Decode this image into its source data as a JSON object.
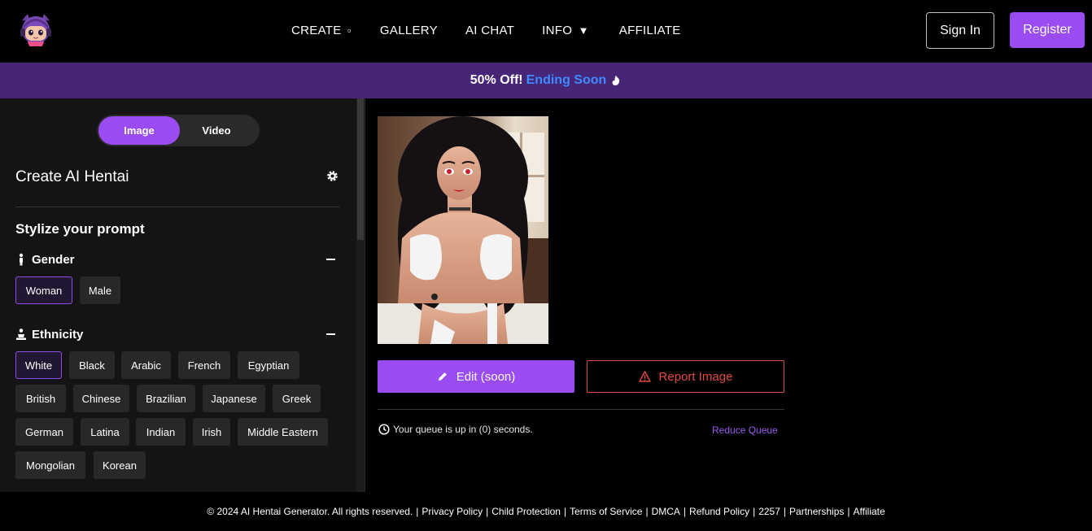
{
  "nav": {
    "links": [
      {
        "label": "CREATE",
        "caret": "▫"
      },
      {
        "label": "GALLERY"
      },
      {
        "label": "AI CHAT"
      },
      {
        "label": "INFO",
        "caret": "▼"
      },
      {
        "label": "AFFILIATE"
      }
    ],
    "signin_label": "Sign In",
    "register_label": "Register"
  },
  "promo": {
    "text": "50% Off!",
    "ending": "Ending Soon"
  },
  "sidebar": {
    "tabs": [
      "Image",
      "Video"
    ],
    "active_tab": "Image",
    "title": "Create AI Hentai",
    "subtitle": "Stylize your prompt",
    "sections": [
      {
        "label": "Gender",
        "options": [
          "Woman",
          "Male"
        ],
        "selected": "Woman"
      },
      {
        "label": "Ethnicity",
        "options": [
          "White",
          "Black",
          "Arabic",
          "French",
          "Egyptian",
          "British",
          "Chinese",
          "Brazilian",
          "Japanese",
          "Greek",
          "German",
          "Latina",
          "Indian",
          "Irish",
          "Middle Eastern",
          "Mongolian",
          "Korean"
        ],
        "selected": "White"
      }
    ]
  },
  "main": {
    "edit_label": "Edit (soon)",
    "report_label": "Report Image",
    "queue_text": "Your queue is up in (0) seconds.",
    "reduce_label": "Reduce Queue"
  },
  "footer": {
    "copyright": "© 2024 AI Hentai Generator. All rights reserved.",
    "links": [
      "Privacy Policy",
      "Child Protection",
      "Terms of Service",
      "DMCA",
      "Refund Policy",
      "2257",
      "Partnerships",
      "Affiliate"
    ]
  },
  "colors": {
    "accent": "#9a4cf2",
    "promo_bg": "#472577",
    "ending_soon": "#3d8bff",
    "report": "#e04a3f",
    "sidebar_bg": "#141414"
  },
  "icons": [
    "logo-mascot-icon",
    "caret-icon",
    "fire-icon",
    "gear-icon",
    "person-icon",
    "ethnicity-icon",
    "minus-icon",
    "pencil-icon",
    "warning-icon",
    "clock-icon"
  ]
}
